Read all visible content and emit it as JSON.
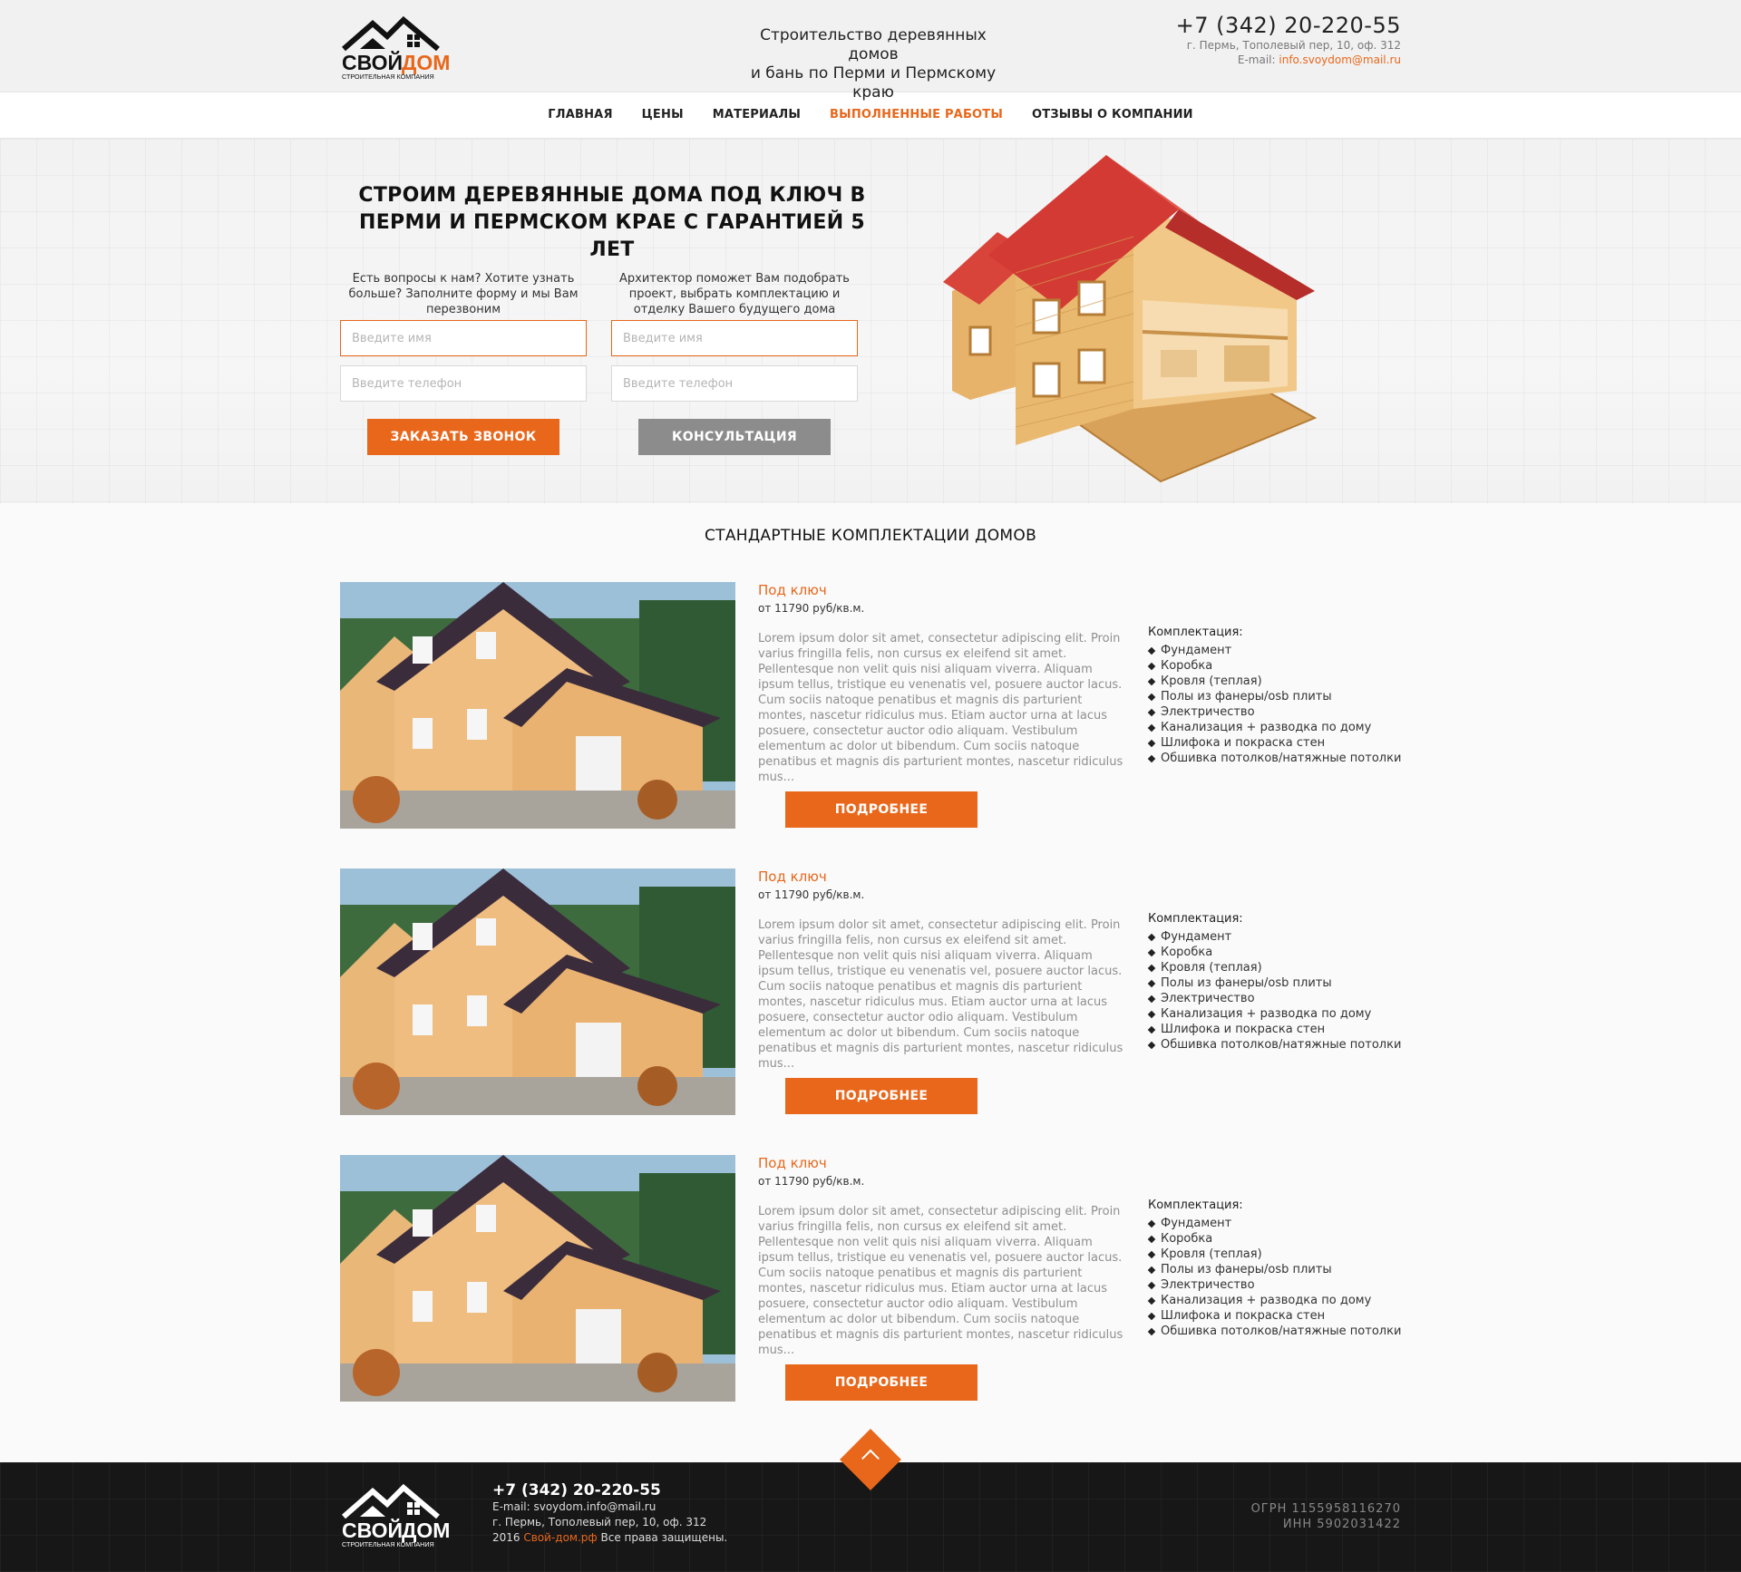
{
  "header": {
    "logo_brand_1": "СВОЙ",
    "logo_brand_2": "ДОМ",
    "logo_sub": "СТРОИТЕЛЬНАЯ КОМПАНИЯ",
    "tagline_1": "Строительство деревянных домов",
    "tagline_2": "и бань по Перми и Пермскому краю",
    "phone": "+7 (342) 20-220-55",
    "address": "г. Пермь, Тополевый пер, 10, оф. 312",
    "email_label": "E-mail: ",
    "email": "info.svoydom@mail.ru"
  },
  "nav": {
    "items": [
      {
        "label": "ГЛАВНАЯ"
      },
      {
        "label": "ЦЕНЫ"
      },
      {
        "label": "МАТЕРИАЛЫ"
      },
      {
        "label": "ВЫПОЛНЕННЫЕ РАБОТЫ"
      },
      {
        "label": "ОТЗЫВЫ О КОМПАНИИ"
      }
    ]
  },
  "hero": {
    "title_1": "СТРОИМ ДЕРЕВЯННЫЕ ДОМА ПОД КЛЮЧ В",
    "title_2": "ПЕРМИ И ПЕРМСКОМ КРАЕ С ГАРАНТИЕЙ 5 ЛЕТ",
    "callback": {
      "hint": "Есть вопросы к нам? Хотите узнать больше? Заполните форму и мы Вам перезвоним",
      "name_placeholder": "Введите имя",
      "phone_placeholder": "Введите телефон",
      "button": "ЗАКАЗАТЬ ЗВОНОК"
    },
    "consult": {
      "hint": "Архитектор поможет Вам подобрать проект, выбрать комплектацию и отделку Вашего будущего дома",
      "name_placeholder": "Введите имя",
      "phone_placeholder": "Введите телефон",
      "button": "КОНСУЛЬТАЦИЯ"
    }
  },
  "packages": {
    "title": "СТАНДАРТНЫЕ КОМПЛЕКТАЦИИ ДОМОВ",
    "items": [
      {
        "kind": "Под ключ",
        "price": "от 11790 руб/кв.м.",
        "description": "Lorem ipsum dolor sit amet, consectetur adipiscing elit. Proin varius fringilla felis, non cursus ex eleifend sit amet. Pellentesque non velit quis nisi aliquam viverra. Aliquam ipsum tellus, tristique eu venenatis vel, posuere auctor lacus. Cum sociis natoque penatibus et magnis dis parturient montes, nascetur ridiculus mus. Etiam auctor urna at lacus posuere, consectetur auctor odio aliquam. Vestibulum elementum ac dolor ut bibendum. Cum sociis natoque penatibus et magnis dis parturient montes, nascetur ridiculus mus...",
        "button": "ПОДРОБНЕЕ",
        "kit_title": "Комплектация:",
        "kit": [
          "Фундамент",
          "Коробка",
          "Кровля (теплая)",
          "Полы из фанеры/osb плиты",
          "Электричество",
          "Канализация + разводка по дому",
          "Шлифока и покраска стен",
          "Обшивка потолков/натяжные потолки"
        ]
      },
      {
        "kind": "Под ключ",
        "price": "от 11790 руб/кв.м.",
        "description": "Lorem ipsum dolor sit amet, consectetur adipiscing elit. Proin varius fringilla felis, non cursus ex eleifend sit amet. Pellentesque non velit quis nisi aliquam viverra. Aliquam ipsum tellus, tristique eu venenatis vel, posuere auctor lacus. Cum sociis natoque penatibus et magnis dis parturient montes, nascetur ridiculus mus. Etiam auctor urna at lacus posuere, consectetur auctor odio aliquam. Vestibulum elementum ac dolor ut bibendum. Cum sociis natoque penatibus et magnis dis parturient montes, nascetur ridiculus mus...",
        "button": "ПОДРОБНЕЕ",
        "kit_title": "Комплектация:",
        "kit": [
          "Фундамент",
          "Коробка",
          "Кровля (теплая)",
          "Полы из фанеры/osb плиты",
          "Электричество",
          "Канализация + разводка по дому",
          "Шлифока и покраска стен",
          "Обшивка потолков/натяжные потолки"
        ]
      },
      {
        "kind": "Под ключ",
        "price": "от 11790 руб/кв.м.",
        "description": "Lorem ipsum dolor sit amet, consectetur adipiscing elit. Proin varius fringilla felis, non cursus ex eleifend sit amet. Pellentesque non velit quis nisi aliquam viverra. Aliquam ipsum tellus, tristique eu venenatis vel, posuere auctor lacus. Cum sociis natoque penatibus et magnis dis parturient montes, nascetur ridiculus mus. Etiam auctor urna at lacus posuere, consectetur auctor odio aliquam. Vestibulum elementum ac dolor ut bibendum. Cum sociis natoque penatibus et magnis dis parturient montes, nascetur ridiculus mus...",
        "button": "ПОДРОБНЕЕ",
        "kit_title": "Комплектация:",
        "kit": [
          "Фундамент",
          "Коробка",
          "Кровля (теплая)",
          "Полы из фанеры/osb плиты",
          "Электричество",
          "Канализация + разводка по дому",
          "Шлифока и покраска стен",
          "Обшивка потолков/натяжные потолки"
        ]
      }
    ]
  },
  "footer": {
    "phone": "+7 (342) 20-220-55",
    "email_label": "E-mail: ",
    "email": "svoydom.info@mail.ru",
    "address": "г. Пермь, Тополевый пер, 10, оф. 312",
    "copy_year": "2016 ",
    "copy_site": "Свой-дом.рф",
    "copy_rest": " Все права защищены.",
    "ogrn": "ОГРН 1155958116270",
    "inn": "ИНН 5902031422"
  },
  "colors": {
    "accent": "#e8671b",
    "secondary_button": "#8c8c8c",
    "footer_bg": "#171717"
  },
  "icons": {
    "scroll_up": "chevron-up-icon"
  }
}
